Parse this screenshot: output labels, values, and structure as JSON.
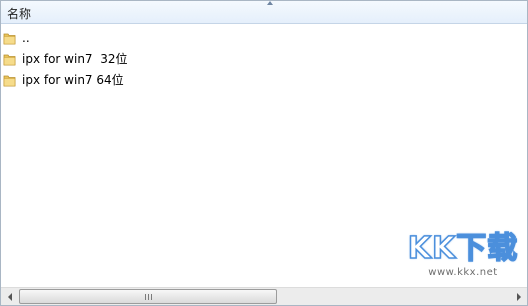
{
  "header": {
    "column_name": "名称"
  },
  "files": [
    {
      "name": "..",
      "icon": "folder-icon"
    },
    {
      "name": "ipx for win7  32位",
      "icon": "folder-icon"
    },
    {
      "name": "ipx for win7 64位",
      "icon": "folder-icon"
    }
  ],
  "watermark": {
    "main": "KK下载",
    "url": "www.kkx.net"
  },
  "colors": {
    "header_bg": "#e5effb",
    "folder": "#e9c35a",
    "watermark_stroke": "#4b8fdc"
  }
}
